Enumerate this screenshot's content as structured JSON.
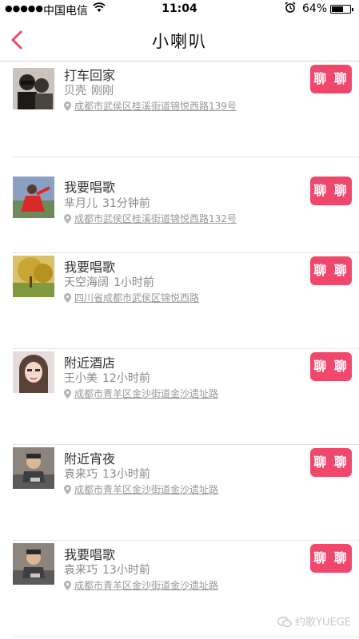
{
  "status_bar": {
    "signal": "●●●●●",
    "carrier": "中国电信",
    "time": "11:04",
    "battery_percent": "64%",
    "battery_level": 0.64
  },
  "nav": {
    "title": "小喇叭",
    "accent_color": "#f0476c"
  },
  "items": [
    {
      "topic": "打车回家",
      "name": "贝壳",
      "time": "刚刚",
      "address": "成都市武侯区桂溪街道锦悦西路139号",
      "button": "聊 聊",
      "avatar": "couple-photo"
    },
    {
      "topic": "我要唱歌",
      "name": "芈月儿",
      "time": "31分钟前",
      "address": "成都市武侯区桂溪街道锦悦西路132号",
      "button": "聊 聊",
      "avatar": "red-dress-photo"
    },
    {
      "topic": "我要唱歌",
      "name": "天空海阔",
      "time": "1小时前",
      "address": "四川省成都市武侯区锦悦西路",
      "button": "聊 聊",
      "avatar": "tree-landscape-photo"
    },
    {
      "topic": "附近酒店",
      "name": "王小美",
      "time": "12小时前",
      "address": "成都市青羊区金沙街道金沙遗址路",
      "button": "聊 聊",
      "avatar": "girl-selfie-photo"
    },
    {
      "topic": "附近宵夜",
      "name": "袁来巧",
      "time": "13小时前",
      "address": "成都市青羊区金沙街道金沙遗址路",
      "button": "聊 聊",
      "avatar": "man-photo"
    },
    {
      "topic": "我要唱歌",
      "name": "袁来巧",
      "time": "13小时前",
      "address": "成都市青羊区金沙街道金沙遗址路",
      "button": "聊 聊",
      "avatar": "man-photo"
    }
  ],
  "watermark": "约歌YUEGE"
}
